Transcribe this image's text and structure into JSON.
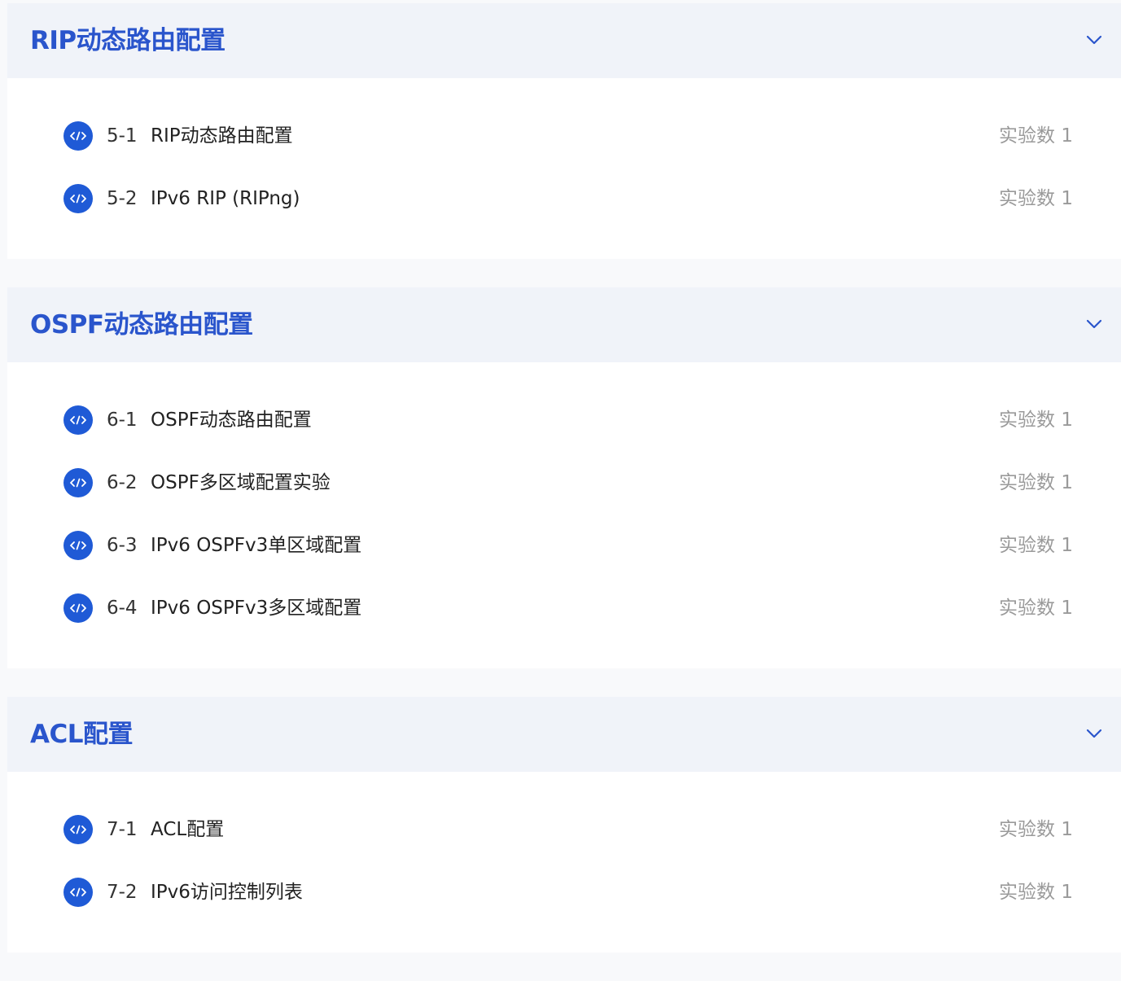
{
  "accent_color": "#2a55cc",
  "icon_color": "#1f5ad6",
  "count_label": "实验数 1",
  "sections": [
    {
      "title": "RIP动态路由配置",
      "items": [
        {
          "num": "5-1",
          "title": "RIP动态路由配置",
          "count": "实验数 1"
        },
        {
          "num": "5-2",
          "title": "IPv6 RIP (RIPng)",
          "count": "实验数 1"
        }
      ]
    },
    {
      "title": "OSPF动态路由配置",
      "items": [
        {
          "num": "6-1",
          "title": "OSPF动态路由配置",
          "count": "实验数 1"
        },
        {
          "num": "6-2",
          "title": "OSPF多区域配置实验",
          "count": "实验数 1"
        },
        {
          "num": "6-3",
          "title": "IPv6 OSPFv3单区域配置",
          "count": "实验数 1"
        },
        {
          "num": "6-4",
          "title": "IPv6 OSPFv3多区域配置",
          "count": "实验数 1"
        }
      ]
    },
    {
      "title": "ACL配置",
      "items": [
        {
          "num": "7-1",
          "title": "ACL配置",
          "count": "实验数 1"
        },
        {
          "num": "7-2",
          "title": "IPv6访问控制列表",
          "count": "实验数 1"
        }
      ]
    }
  ],
  "icons": {
    "item_icon": "code-icon",
    "toggle_icon": "chevron-down-icon"
  }
}
